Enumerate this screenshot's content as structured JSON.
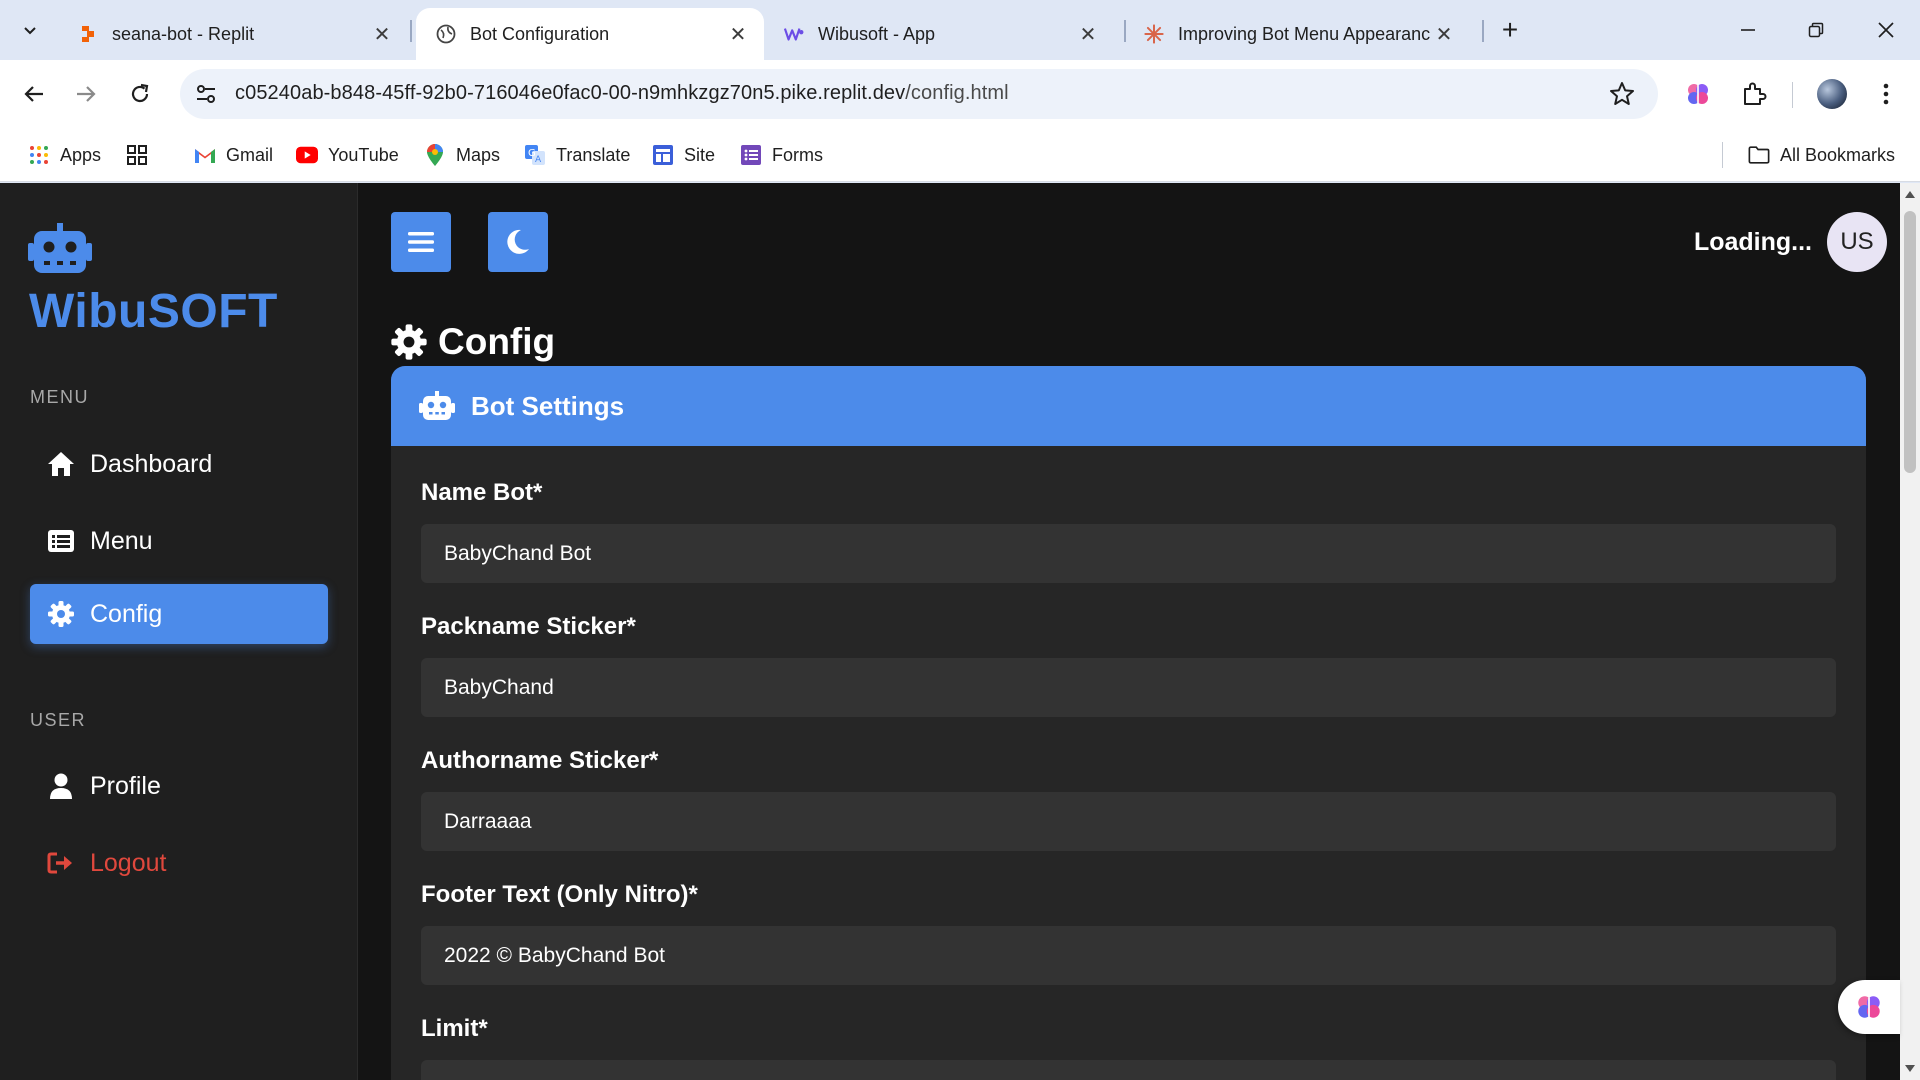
{
  "browser": {
    "tabs": [
      {
        "title": "seana-bot - Replit",
        "active": false
      },
      {
        "title": "Bot Configuration",
        "active": true
      },
      {
        "title": "Wibusoft - App",
        "active": false
      },
      {
        "title": "Improving Bot Menu Appearanc",
        "active": false
      }
    ],
    "url_host": "c05240ab-b848-45ff-92b0-716046e0fac0-00-n9mhkzgz70n5.pike.replit.dev",
    "url_path": "/config.html",
    "bookmarks": [
      "Apps",
      "Gmail",
      "YouTube",
      "Maps",
      "Translate",
      "Site",
      "Forms"
    ],
    "all_bookmarks": "All Bookmarks"
  },
  "sidebar": {
    "brand": "WibuSOFT",
    "menu_label": "MENU",
    "menu_items": [
      {
        "label": "Dashboard",
        "icon": "home-icon",
        "active": false
      },
      {
        "label": "Menu",
        "icon": "list-icon",
        "active": false
      },
      {
        "label": "Config",
        "icon": "gear-icon",
        "active": true
      }
    ],
    "user_label": "USER",
    "user_items": [
      {
        "label": "Profile",
        "icon": "user-icon"
      },
      {
        "label": "Logout",
        "icon": "logout-icon"
      }
    ]
  },
  "header": {
    "status": "Loading...",
    "avatar_initials": "US"
  },
  "page": {
    "title": "Config",
    "card_title": "Bot Settings",
    "fields": [
      {
        "label": "Name Bot*",
        "value": "BabyChand Bot"
      },
      {
        "label": "Packname Sticker*",
        "value": "BabyChand"
      },
      {
        "label": "Authorname Sticker*",
        "value": "Darraaaa"
      },
      {
        "label": "Footer Text (Only Nitro)*",
        "value": "2022 © BabyChand Bot"
      },
      {
        "label": "Limit*",
        "value": ""
      }
    ]
  },
  "colors": {
    "accent": "#4c8bea",
    "sidebar_bg": "#1f1f1f",
    "page_bg": "#141414",
    "card_bg": "#262626",
    "input_bg": "#333333",
    "logout": "#e0483d"
  }
}
